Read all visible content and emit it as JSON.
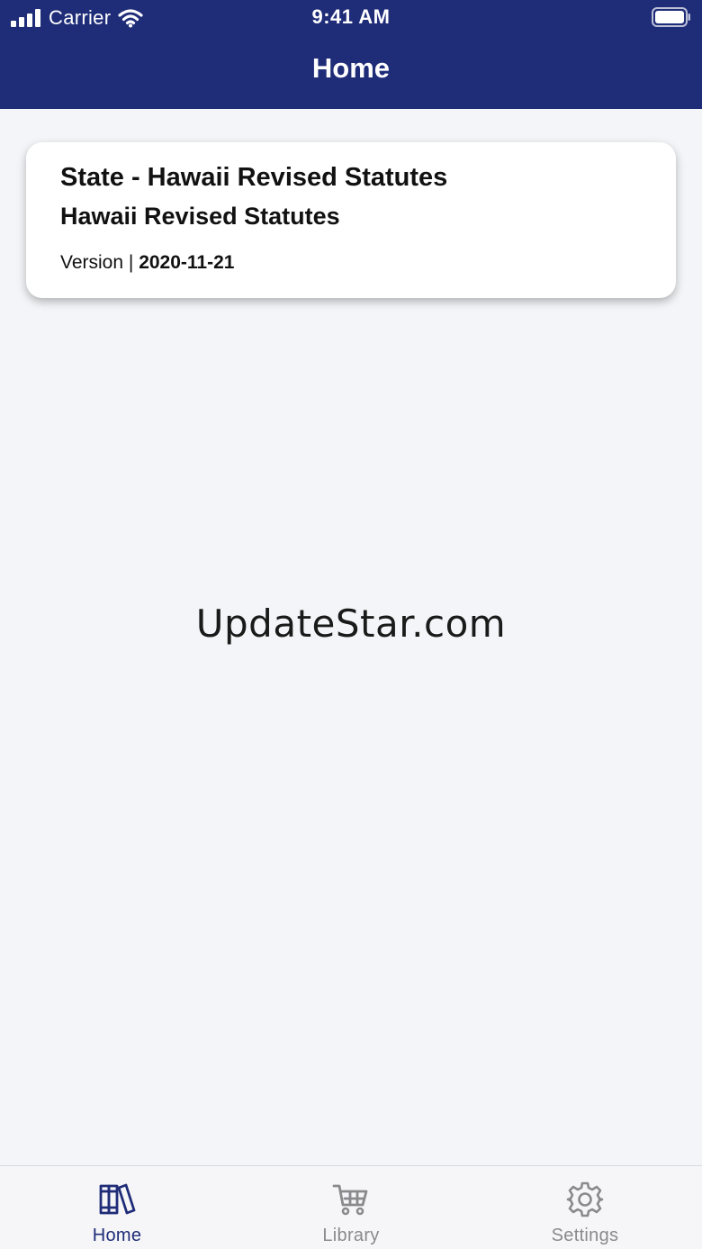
{
  "status_bar": {
    "carrier": "Carrier",
    "time": "9:41 AM"
  },
  "nav": {
    "title": "Home"
  },
  "card": {
    "title": "State - Hawaii Revised Statutes",
    "subtitle": "Hawaii Revised Statutes",
    "version_label": "Version |",
    "version_date": "2020-11-21"
  },
  "watermark": "UpdateStar.com",
  "tabs": [
    {
      "label": "Home",
      "icon": "books-icon",
      "active": true
    },
    {
      "label": "Library",
      "icon": "cart-icon",
      "active": false
    },
    {
      "label": "Settings",
      "icon": "gear-icon",
      "active": false
    }
  ],
  "colors": {
    "brand": "#1f2c78",
    "background": "#f3f5f8",
    "inactive": "#8a8a8e"
  }
}
